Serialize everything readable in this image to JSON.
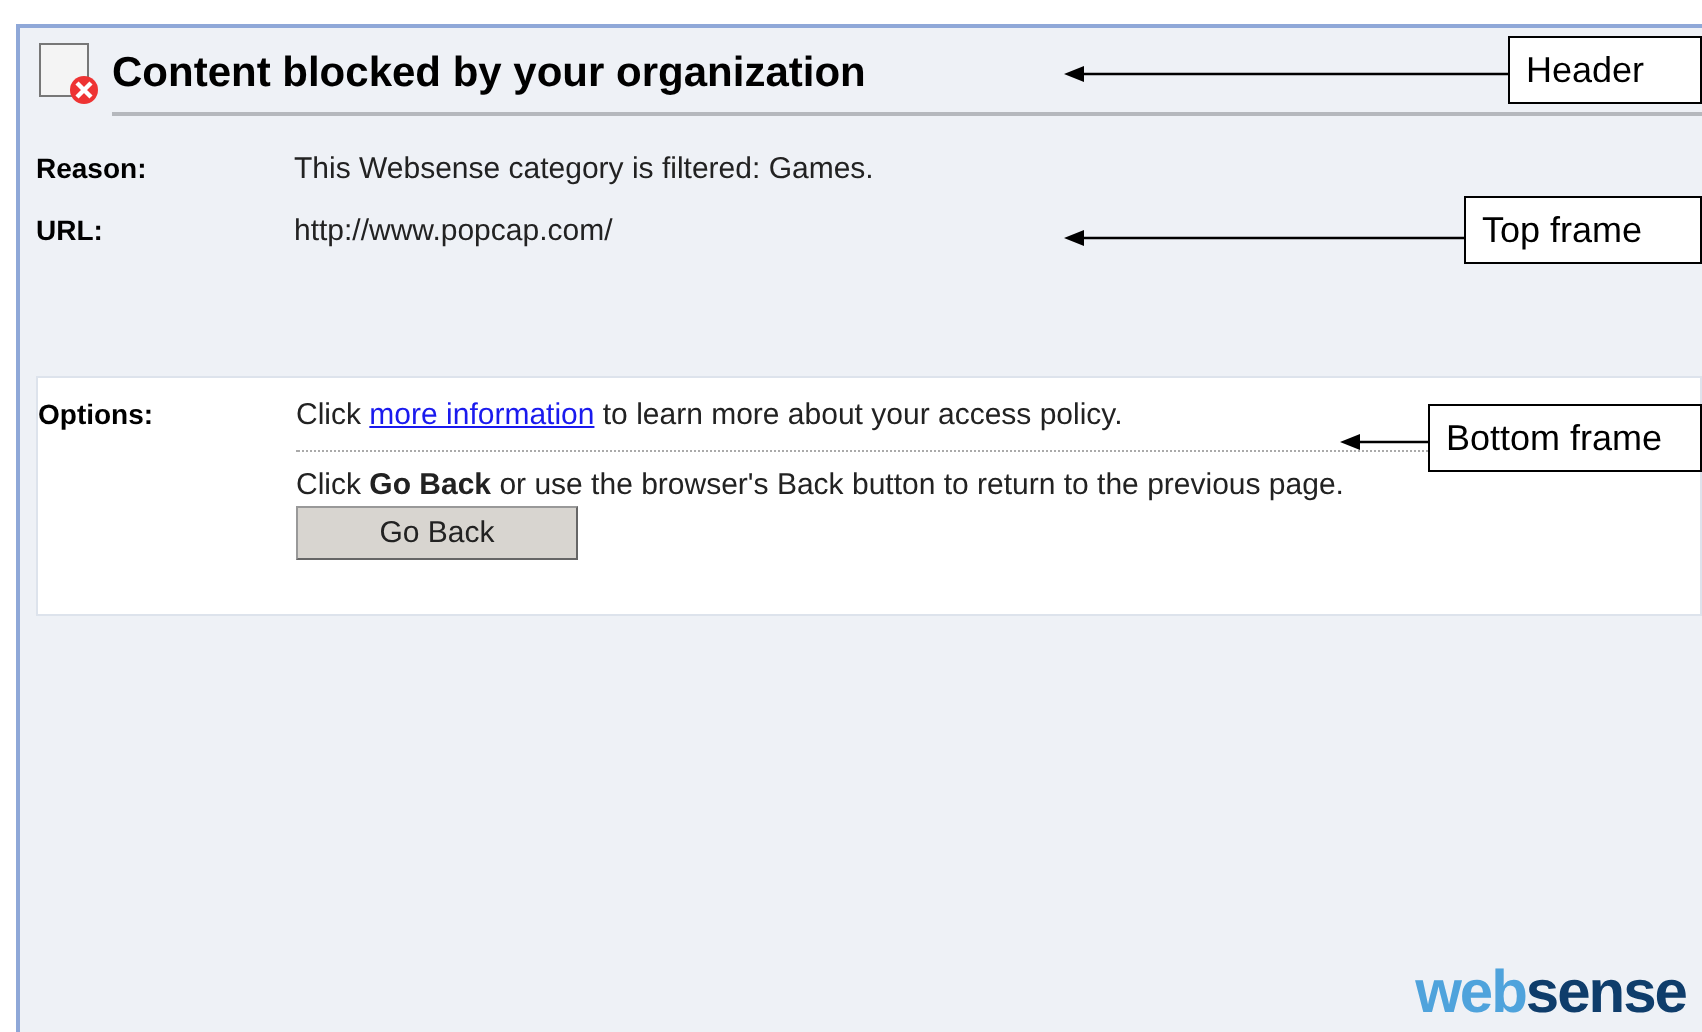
{
  "header": {
    "title": "Content blocked by your organization"
  },
  "top_frame": {
    "rows": [
      {
        "label": "Reason:",
        "value": "This Websense category is filtered: Games."
      },
      {
        "label": "URL:",
        "value": "http://www.popcap.com/"
      }
    ]
  },
  "bottom_frame": {
    "label": "Options:",
    "info_before": "Click ",
    "info_link": "more information",
    "info_after": " to learn more about your access policy.",
    "back_text": "Click **Go Back** or use the browser's Back button to return to the previous page.",
    "button": "Go Back"
  },
  "logo": {
    "part_1": "web",
    "part_2": "sense"
  },
  "callouts": [
    {
      "text": "Header"
    },
    {
      "text": "Top frame"
    },
    {
      "text": "Bottom frame"
    }
  ]
}
